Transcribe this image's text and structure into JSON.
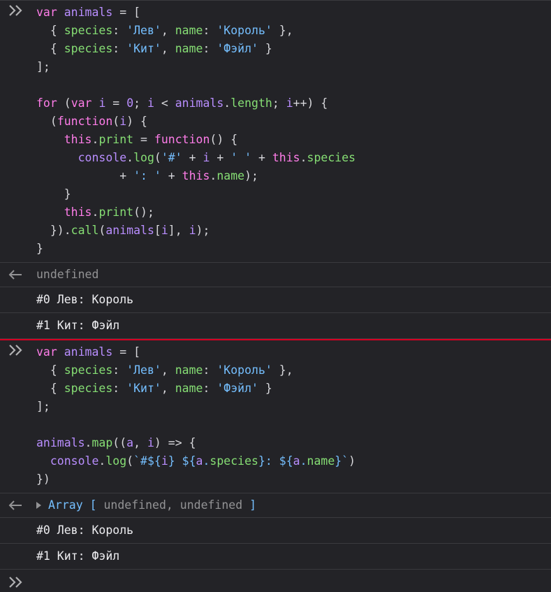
{
  "entries": [
    {
      "input_lines": [
        [
          [
            "kw",
            "var"
          ],
          [
            "punc",
            " "
          ],
          [
            "var",
            "animals"
          ],
          [
            "punc",
            " = ["
          ]
        ],
        [
          [
            "punc",
            "  { "
          ],
          [
            "prop",
            "species"
          ],
          [
            "punc",
            ": "
          ],
          [
            "str",
            "'Лев'"
          ],
          [
            "punc",
            ", "
          ],
          [
            "prop",
            "name"
          ],
          [
            "punc",
            ": "
          ],
          [
            "str",
            "'Король'"
          ],
          [
            "punc",
            " },"
          ]
        ],
        [
          [
            "punc",
            "  { "
          ],
          [
            "prop",
            "species"
          ],
          [
            "punc",
            ": "
          ],
          [
            "str",
            "'Кит'"
          ],
          [
            "punc",
            ", "
          ],
          [
            "prop",
            "name"
          ],
          [
            "punc",
            ": "
          ],
          [
            "str",
            "'Фэйл'"
          ],
          [
            "punc",
            " }"
          ]
        ],
        [
          [
            "punc",
            "];"
          ]
        ],
        [
          [
            "punc",
            ""
          ]
        ],
        [
          [
            "kw",
            "for"
          ],
          [
            "punc",
            " ("
          ],
          [
            "kw",
            "var"
          ],
          [
            "punc",
            " "
          ],
          [
            "var",
            "i"
          ],
          [
            "punc",
            " = "
          ],
          [
            "num",
            "0"
          ],
          [
            "punc",
            "; "
          ],
          [
            "var",
            "i"
          ],
          [
            "punc",
            " < "
          ],
          [
            "var",
            "animals"
          ],
          [
            "punc",
            "."
          ],
          [
            "prop",
            "length"
          ],
          [
            "punc",
            "; "
          ],
          [
            "var",
            "i"
          ],
          [
            "punc",
            "++) {"
          ]
        ],
        [
          [
            "punc",
            "  ("
          ],
          [
            "kw",
            "function"
          ],
          [
            "punc",
            "("
          ],
          [
            "var",
            "i"
          ],
          [
            "punc",
            ") {"
          ]
        ],
        [
          [
            "punc",
            "    "
          ],
          [
            "kw",
            "this"
          ],
          [
            "punc",
            "."
          ],
          [
            "prop",
            "print"
          ],
          [
            "punc",
            " = "
          ],
          [
            "kw",
            "function"
          ],
          [
            "punc",
            "() {"
          ]
        ],
        [
          [
            "punc",
            "      "
          ],
          [
            "var",
            "console"
          ],
          [
            "punc",
            "."
          ],
          [
            "prop",
            "log"
          ],
          [
            "punc",
            "("
          ],
          [
            "str",
            "'#'"
          ],
          [
            "punc",
            " + "
          ],
          [
            "var",
            "i"
          ],
          [
            "punc",
            " + "
          ],
          [
            "str",
            "' '"
          ],
          [
            "punc",
            " + "
          ],
          [
            "kw",
            "this"
          ],
          [
            "punc",
            "."
          ],
          [
            "prop",
            "species"
          ]
        ],
        [
          [
            "punc",
            "            + "
          ],
          [
            "str",
            "': '"
          ],
          [
            "punc",
            " + "
          ],
          [
            "kw",
            "this"
          ],
          [
            "punc",
            "."
          ],
          [
            "prop",
            "name"
          ],
          [
            "punc",
            ");"
          ]
        ],
        [
          [
            "punc",
            "    }"
          ]
        ],
        [
          [
            "punc",
            "    "
          ],
          [
            "kw",
            "this"
          ],
          [
            "punc",
            "."
          ],
          [
            "prop",
            "print"
          ],
          [
            "punc",
            "();"
          ]
        ],
        [
          [
            "punc",
            "  })."
          ],
          [
            "prop",
            "call"
          ],
          [
            "punc",
            "("
          ],
          [
            "var",
            "animals"
          ],
          [
            "punc",
            "["
          ],
          [
            "var",
            "i"
          ],
          [
            "punc",
            "], "
          ],
          [
            "var",
            "i"
          ],
          [
            "punc",
            ");"
          ]
        ],
        [
          [
            "punc",
            "}"
          ]
        ]
      ],
      "result_type": "plain",
      "result_text": "undefined",
      "logs": [
        "#0 Лев: Король",
        "#1 Кит: Фэйл"
      ]
    },
    {
      "input_lines": [
        [
          [
            "kw",
            "var"
          ],
          [
            "punc",
            " "
          ],
          [
            "var",
            "animals"
          ],
          [
            "punc",
            " = ["
          ]
        ],
        [
          [
            "punc",
            "  { "
          ],
          [
            "prop",
            "species"
          ],
          [
            "punc",
            ": "
          ],
          [
            "str",
            "'Лев'"
          ],
          [
            "punc",
            ", "
          ],
          [
            "prop",
            "name"
          ],
          [
            "punc",
            ": "
          ],
          [
            "str",
            "'Король'"
          ],
          [
            "punc",
            " },"
          ]
        ],
        [
          [
            "punc",
            "  { "
          ],
          [
            "prop",
            "species"
          ],
          [
            "punc",
            ": "
          ],
          [
            "str",
            "'Кит'"
          ],
          [
            "punc",
            ", "
          ],
          [
            "prop",
            "name"
          ],
          [
            "punc",
            ": "
          ],
          [
            "str",
            "'Фэйл'"
          ],
          [
            "punc",
            " }"
          ]
        ],
        [
          [
            "punc",
            "];"
          ]
        ],
        [
          [
            "punc",
            ""
          ]
        ],
        [
          [
            "var",
            "animals"
          ],
          [
            "punc",
            "."
          ],
          [
            "prop",
            "map"
          ],
          [
            "punc",
            "(("
          ],
          [
            "var",
            "a"
          ],
          [
            "punc",
            ", "
          ],
          [
            "var",
            "i"
          ],
          [
            "punc",
            ") => {"
          ]
        ],
        [
          [
            "punc",
            "  "
          ],
          [
            "var",
            "console"
          ],
          [
            "punc",
            "."
          ],
          [
            "prop",
            "log"
          ],
          [
            "punc",
            "("
          ],
          [
            "str",
            "`#${"
          ],
          [
            "var",
            "i"
          ],
          [
            "str",
            "} ${"
          ],
          [
            "var",
            "a"
          ],
          [
            "str",
            "."
          ],
          [
            "prop",
            "species"
          ],
          [
            "str",
            "}: ${"
          ],
          [
            "var",
            "a"
          ],
          [
            "str",
            "."
          ],
          [
            "prop",
            "name"
          ],
          [
            "str",
            "}`"
          ],
          [
            "punc",
            ")"
          ]
        ],
        [
          [
            "punc",
            "})"
          ]
        ]
      ],
      "result_type": "array",
      "result_array": {
        "name": "Array",
        "open": "[",
        "items": [
          "undefined",
          "undefined"
        ],
        "sep": ", ",
        "close": "]"
      },
      "logs": [
        "#0 Лев: Король",
        "#1 Кит: Фэйл"
      ]
    }
  ],
  "icons": {
    "prompt": "chevron-double-right-icon",
    "result": "arrow-left-icon"
  },
  "colors": {
    "background": "#232327",
    "keyword": "#ff7de9",
    "variable": "#b98eff",
    "property": "#86de74",
    "string": "#75bfff",
    "divider_red": "#d70022"
  }
}
